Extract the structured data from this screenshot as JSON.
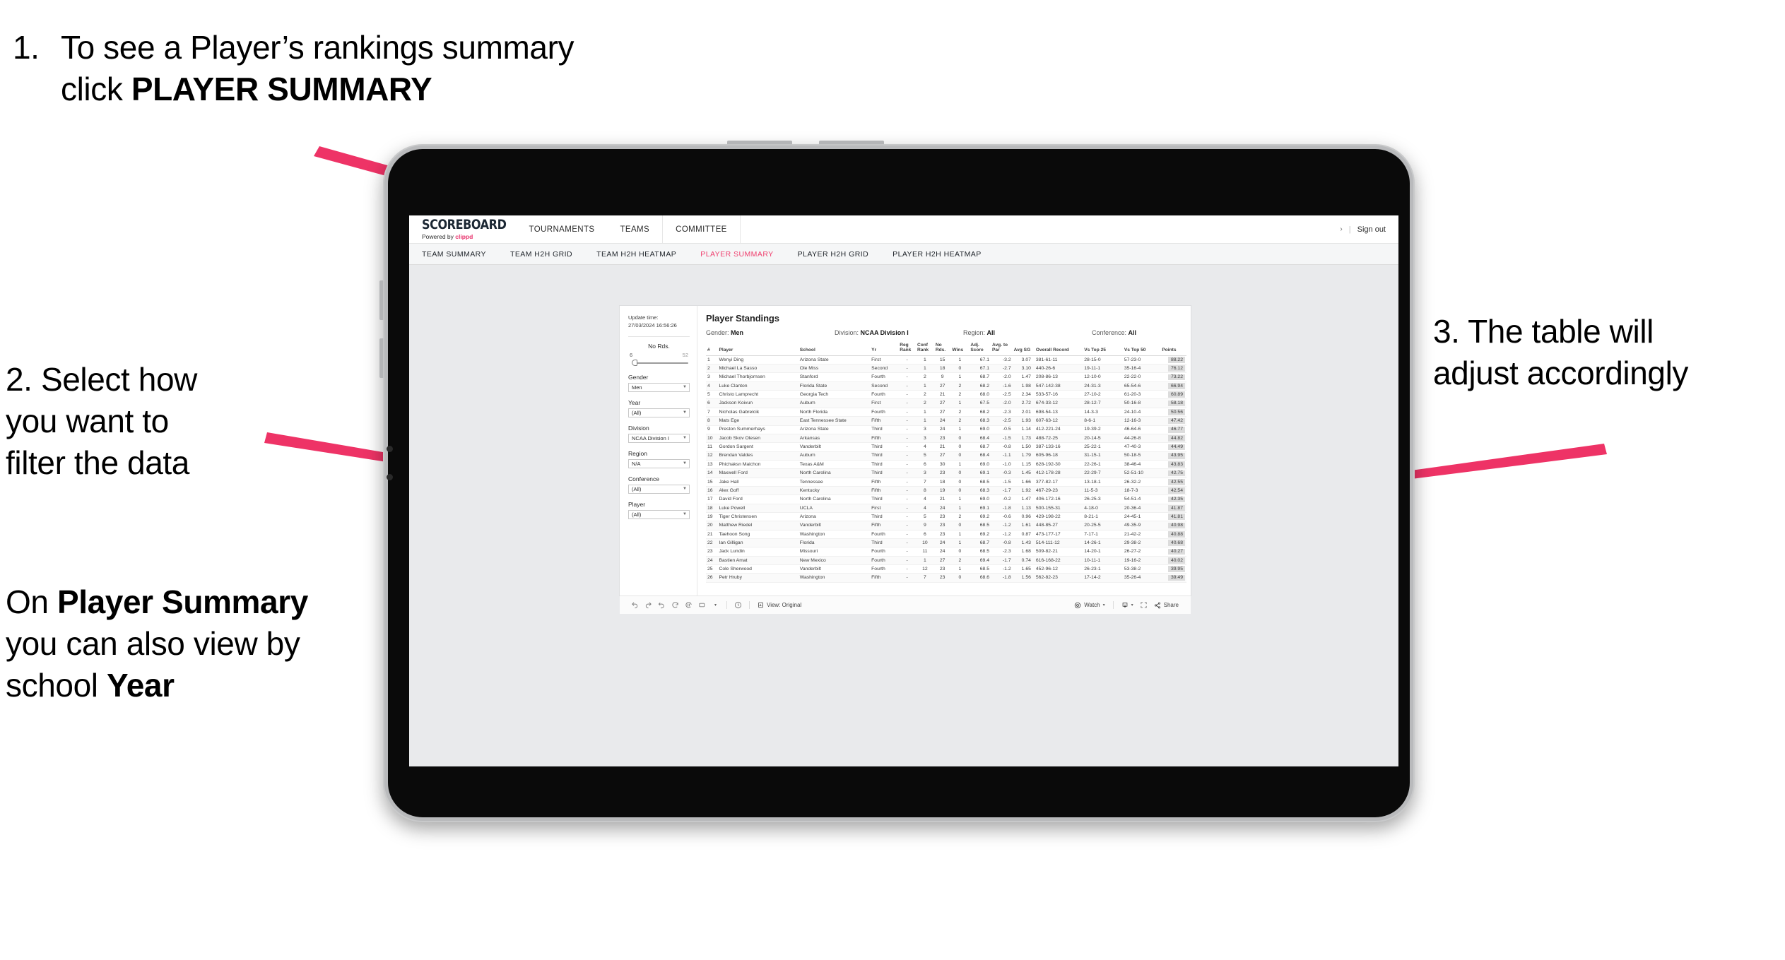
{
  "annotations": {
    "step1_number": "1.",
    "step1_pre": "To see a Player’s rankings summary click ",
    "step1_bold": "PLAYER SUMMARY",
    "step2_line1": "2. Select how",
    "step2_line2": "you want to",
    "step2_line3": "filter the data",
    "step3_pre1": "On ",
    "step3_bold1": "Player Summary",
    "step3_mid": " you can also view by school ",
    "step3_bold2": "Year",
    "step4_line1": "3. The table will",
    "step4_line2": "adjust accordingly",
    "arrow_color": "#ee3366"
  },
  "app": {
    "brand_name": "SCOREBOARD",
    "brand_powered_pre": "Powered by ",
    "brand_powered_name": "clippd",
    "brand_accent": "#e8336d",
    "top_nav": [
      "TOURNAMENTS",
      "TEAMS",
      "COMMITTEE"
    ],
    "sign_out": "Sign out",
    "account_caret": "›",
    "divider": "|",
    "sub_nav": [
      {
        "label": "TEAM SUMMARY",
        "active": false
      },
      {
        "label": "TEAM H2H GRID",
        "active": false
      },
      {
        "label": "TEAM H2H HEATMAP",
        "active": false
      },
      {
        "label": "PLAYER SUMMARY",
        "active": true
      },
      {
        "label": "PLAYER H2H GRID",
        "active": false
      },
      {
        "label": "PLAYER H2H HEATMAP",
        "active": false
      }
    ],
    "active_tab_color": "#ef3e6d"
  },
  "filters": {
    "update_time_label": "Update time:",
    "update_time_value": "27/03/2024 16:56:26",
    "slider": {
      "title": "No Rds.",
      "min": "6",
      "max": "52"
    },
    "controls": [
      {
        "label": "Gender",
        "value": "Men"
      },
      {
        "label": "Year",
        "value": "(All)"
      },
      {
        "label": "Division",
        "value": "NCAA Division I"
      },
      {
        "label": "Region",
        "value": "N/A"
      },
      {
        "label": "Conference",
        "value": "(All)"
      },
      {
        "label": "Player",
        "value": "(All)"
      }
    ],
    "caret": "▼"
  },
  "viz": {
    "title": "Player Standings",
    "meta": [
      {
        "label": "Gender: ",
        "value": "Men"
      },
      {
        "label": "Division: ",
        "value": "NCAA Division I"
      },
      {
        "label": "Region: ",
        "value": "All"
      },
      {
        "label": "Conference: ",
        "value": "All"
      }
    ],
    "columns": [
      "#",
      "Player",
      "School",
      "Yr",
      "Reg Rank",
      "Conf Rank",
      "No Rds.",
      "Wins",
      "Adj. Score",
      "Avg. to Par",
      "Avg SG",
      "Overall Record",
      "Vs Top 25",
      "Vs Top 50",
      "Points"
    ],
    "rows": [
      {
        "n": "1",
        "player": "Wenyi Ding",
        "school": "Arizona State",
        "yr": "First",
        "rr": "-",
        "cr": "1",
        "nr": "15",
        "w": "1",
        "adj": "67.1",
        "par": "-3.2",
        "sg": "3.07",
        "rec": "381-61-11",
        "t25": "28-15-0",
        "t50": "57-23-0",
        "pts": "88.22"
      },
      {
        "n": "2",
        "player": "Michael La Sasso",
        "school": "Ole Miss",
        "yr": "Second",
        "rr": "-",
        "cr": "1",
        "nr": "18",
        "w": "0",
        "adj": "67.1",
        "par": "-2.7",
        "sg": "3.10",
        "rec": "440-26-6",
        "t25": "19-11-1",
        "t50": "35-16-4",
        "pts": "76.12"
      },
      {
        "n": "3",
        "player": "Michael Thorbjornsen",
        "school": "Stanford",
        "yr": "Fourth",
        "rr": "-",
        "cr": "2",
        "nr": "9",
        "w": "1",
        "adj": "68.7",
        "par": "-2.0",
        "sg": "1.47",
        "rec": "208-86-13",
        "t25": "12-10-0",
        "t50": "22-22-0",
        "pts": "73.22"
      },
      {
        "n": "4",
        "player": "Luke Clanton",
        "school": "Florida State",
        "yr": "Second",
        "rr": "-",
        "cr": "1",
        "nr": "27",
        "w": "2",
        "adj": "68.2",
        "par": "-1.6",
        "sg": "1.98",
        "rec": "547-142-38",
        "t25": "24-31-3",
        "t50": "65-54-6",
        "pts": "66.94"
      },
      {
        "n": "5",
        "player": "Christo Lamprecht",
        "school": "Georgia Tech",
        "yr": "Fourth",
        "rr": "-",
        "cr": "2",
        "nr": "21",
        "w": "2",
        "adj": "68.0",
        "par": "-2.5",
        "sg": "2.34",
        "rec": "533-57-16",
        "t25": "27-10-2",
        "t50": "61-20-3",
        "pts": "60.89"
      },
      {
        "n": "6",
        "player": "Jackson Koivun",
        "school": "Auburn",
        "yr": "First",
        "rr": "-",
        "cr": "2",
        "nr": "27",
        "w": "1",
        "adj": "67.5",
        "par": "-2.0",
        "sg": "2.72",
        "rec": "674-33-12",
        "t25": "28-12-7",
        "t50": "50-16-8",
        "pts": "58.18"
      },
      {
        "n": "7",
        "player": "Nicholas Gabrelcik",
        "school": "North Florida",
        "yr": "Fourth",
        "rr": "-",
        "cr": "1",
        "nr": "27",
        "w": "2",
        "adj": "68.2",
        "par": "-2.3",
        "sg": "2.01",
        "rec": "698-54-13",
        "t25": "14-3-3",
        "t50": "24-10-4",
        "pts": "50.56"
      },
      {
        "n": "8",
        "player": "Mats Ege",
        "school": "East Tennessee State",
        "yr": "Fifth",
        "rr": "-",
        "cr": "1",
        "nr": "24",
        "w": "2",
        "adj": "68.3",
        "par": "-2.5",
        "sg": "1.93",
        "rec": "607-63-12",
        "t25": "8-6-1",
        "t50": "12-16-3",
        "pts": "47.42"
      },
      {
        "n": "9",
        "player": "Preston Summerhays",
        "school": "Arizona State",
        "yr": "Third",
        "rr": "-",
        "cr": "3",
        "nr": "24",
        "w": "1",
        "adj": "69.0",
        "par": "-0.5",
        "sg": "1.14",
        "rec": "412-221-24",
        "t25": "19-39-2",
        "t50": "46-64-6",
        "pts": "46.77"
      },
      {
        "n": "10",
        "player": "Jacob Skov Olesen",
        "school": "Arkansas",
        "yr": "Fifth",
        "rr": "-",
        "cr": "3",
        "nr": "23",
        "w": "0",
        "adj": "68.4",
        "par": "-1.5",
        "sg": "1.73",
        "rec": "488-72-25",
        "t25": "20-14-5",
        "t50": "44-26-8",
        "pts": "44.82"
      },
      {
        "n": "11",
        "player": "Gordon Sargent",
        "school": "Vanderbilt",
        "yr": "Third",
        "rr": "-",
        "cr": "4",
        "nr": "21",
        "w": "0",
        "adj": "68.7",
        "par": "-0.8",
        "sg": "1.50",
        "rec": "387-133-16",
        "t25": "25-22-1",
        "t50": "47-40-3",
        "pts": "44.49"
      },
      {
        "n": "12",
        "player": "Brendan Valdes",
        "school": "Auburn",
        "yr": "Third",
        "rr": "-",
        "cr": "5",
        "nr": "27",
        "w": "0",
        "adj": "68.4",
        "par": "-1.1",
        "sg": "1.79",
        "rec": "605-96-18",
        "t25": "31-15-1",
        "t50": "50-18-5",
        "pts": "43.95"
      },
      {
        "n": "13",
        "player": "Phichaksn Maichon",
        "school": "Texas A&M",
        "yr": "Third",
        "rr": "-",
        "cr": "6",
        "nr": "30",
        "w": "1",
        "adj": "69.0",
        "par": "-1.0",
        "sg": "1.15",
        "rec": "628-192-30",
        "t25": "22-26-1",
        "t50": "38-46-4",
        "pts": "43.83"
      },
      {
        "n": "14",
        "player": "Maxwell Ford",
        "school": "North Carolina",
        "yr": "Third",
        "rr": "-",
        "cr": "3",
        "nr": "23",
        "w": "0",
        "adj": "69.1",
        "par": "-0.3",
        "sg": "1.45",
        "rec": "412-178-28",
        "t25": "22-29-7",
        "t50": "52-51-10",
        "pts": "42.75"
      },
      {
        "n": "15",
        "player": "Jake Hall",
        "school": "Tennessee",
        "yr": "Fifth",
        "rr": "-",
        "cr": "7",
        "nr": "18",
        "w": "0",
        "adj": "68.5",
        "par": "-1.5",
        "sg": "1.66",
        "rec": "377-82-17",
        "t25": "13-18-1",
        "t50": "26-32-2",
        "pts": "42.55"
      },
      {
        "n": "16",
        "player": "Alex Goff",
        "school": "Kentucky",
        "yr": "Fifth",
        "rr": "-",
        "cr": "8",
        "nr": "19",
        "w": "0",
        "adj": "68.3",
        "par": "-1.7",
        "sg": "1.92",
        "rec": "467-29-23",
        "t25": "11-5-3",
        "t50": "18-7-3",
        "pts": "42.54"
      },
      {
        "n": "17",
        "player": "David Ford",
        "school": "North Carolina",
        "yr": "Third",
        "rr": "-",
        "cr": "4",
        "nr": "21",
        "w": "1",
        "adj": "69.0",
        "par": "-0.2",
        "sg": "1.47",
        "rec": "406-172-16",
        "t25": "26-25-3",
        "t50": "54-51-4",
        "pts": "42.35"
      },
      {
        "n": "18",
        "player": "Luke Powell",
        "school": "UCLA",
        "yr": "First",
        "rr": "-",
        "cr": "4",
        "nr": "24",
        "w": "1",
        "adj": "69.1",
        "par": "-1.8",
        "sg": "1.13",
        "rec": "500-155-31",
        "t25": "4-18-0",
        "t50": "20-36-4",
        "pts": "41.87"
      },
      {
        "n": "19",
        "player": "Tiger Christensen",
        "school": "Arizona",
        "yr": "Third",
        "rr": "-",
        "cr": "5",
        "nr": "23",
        "w": "2",
        "adj": "69.2",
        "par": "-0.6",
        "sg": "0.96",
        "rec": "429-198-22",
        "t25": "8-21-1",
        "t50": "24-45-1",
        "pts": "41.81"
      },
      {
        "n": "20",
        "player": "Matthew Riedel",
        "school": "Vanderbilt",
        "yr": "Fifth",
        "rr": "-",
        "cr": "9",
        "nr": "23",
        "w": "0",
        "adj": "68.5",
        "par": "-1.2",
        "sg": "1.61",
        "rec": "448-85-27",
        "t25": "20-25-5",
        "t50": "49-35-9",
        "pts": "40.98"
      },
      {
        "n": "21",
        "player": "Taehoon Song",
        "school": "Washington",
        "yr": "Fourth",
        "rr": "-",
        "cr": "6",
        "nr": "23",
        "w": "1",
        "adj": "69.2",
        "par": "-1.2",
        "sg": "0.87",
        "rec": "473-177-17",
        "t25": "7-17-1",
        "t50": "21-42-2",
        "pts": "40.88"
      },
      {
        "n": "22",
        "player": "Ian Gilligan",
        "school": "Florida",
        "yr": "Third",
        "rr": "-",
        "cr": "10",
        "nr": "24",
        "w": "1",
        "adj": "68.7",
        "par": "-0.8",
        "sg": "1.43",
        "rec": "514-111-12",
        "t25": "14-26-1",
        "t50": "29-38-2",
        "pts": "40.68"
      },
      {
        "n": "23",
        "player": "Jack Lundin",
        "school": "Missouri",
        "yr": "Fourth",
        "rr": "-",
        "cr": "11",
        "nr": "24",
        "w": "0",
        "adj": "68.5",
        "par": "-2.3",
        "sg": "1.68",
        "rec": "509-82-21",
        "t25": "14-20-1",
        "t50": "26-27-2",
        "pts": "40.27"
      },
      {
        "n": "24",
        "player": "Bastien Amat",
        "school": "New Mexico",
        "yr": "Fourth",
        "rr": "-",
        "cr": "1",
        "nr": "27",
        "w": "2",
        "adj": "69.4",
        "par": "-1.7",
        "sg": "0.74",
        "rec": "616-168-22",
        "t25": "10-11-1",
        "t50": "19-16-2",
        "pts": "40.02"
      },
      {
        "n": "25",
        "player": "Cole Sherwood",
        "school": "Vanderbilt",
        "yr": "Fourth",
        "rr": "-",
        "cr": "12",
        "nr": "23",
        "w": "1",
        "adj": "68.5",
        "par": "-1.2",
        "sg": "1.65",
        "rec": "452-96-12",
        "t25": "26-23-1",
        "t50": "53-38-2",
        "pts": "39.95"
      },
      {
        "n": "26",
        "player": "Petr Hruby",
        "school": "Washington",
        "yr": "Fifth",
        "rr": "-",
        "cr": "7",
        "nr": "23",
        "w": "0",
        "adj": "68.6",
        "par": "-1.8",
        "sg": "1.56",
        "rec": "562-82-23",
        "t25": "17-14-2",
        "t50": "35-26-4",
        "pts": "39.49"
      }
    ],
    "toolbar": {
      "view_label": "View: Original",
      "watch_label": "Watch",
      "share_label": "Share",
      "caret": "▾"
    }
  }
}
